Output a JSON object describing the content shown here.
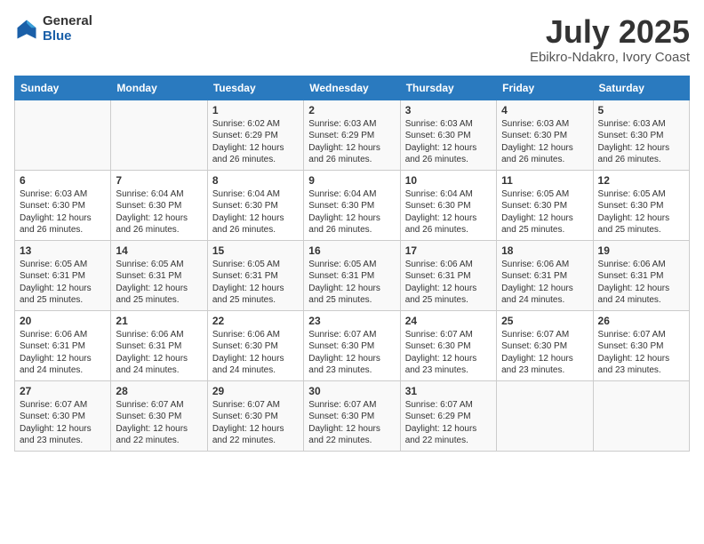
{
  "header": {
    "logo_general": "General",
    "logo_blue": "Blue",
    "title": "July 2025",
    "subtitle": "Ebikro-Ndakro, Ivory Coast"
  },
  "weekdays": [
    "Sunday",
    "Monday",
    "Tuesday",
    "Wednesday",
    "Thursday",
    "Friday",
    "Saturday"
  ],
  "weeks": [
    [
      {
        "day": "",
        "info": ""
      },
      {
        "day": "",
        "info": ""
      },
      {
        "day": "1",
        "info": "Sunrise: 6:02 AM\nSunset: 6:29 PM\nDaylight: 12 hours and 26 minutes."
      },
      {
        "day": "2",
        "info": "Sunrise: 6:03 AM\nSunset: 6:29 PM\nDaylight: 12 hours and 26 minutes."
      },
      {
        "day": "3",
        "info": "Sunrise: 6:03 AM\nSunset: 6:30 PM\nDaylight: 12 hours and 26 minutes."
      },
      {
        "day": "4",
        "info": "Sunrise: 6:03 AM\nSunset: 6:30 PM\nDaylight: 12 hours and 26 minutes."
      },
      {
        "day": "5",
        "info": "Sunrise: 6:03 AM\nSunset: 6:30 PM\nDaylight: 12 hours and 26 minutes."
      }
    ],
    [
      {
        "day": "6",
        "info": "Sunrise: 6:03 AM\nSunset: 6:30 PM\nDaylight: 12 hours and 26 minutes."
      },
      {
        "day": "7",
        "info": "Sunrise: 6:04 AM\nSunset: 6:30 PM\nDaylight: 12 hours and 26 minutes."
      },
      {
        "day": "8",
        "info": "Sunrise: 6:04 AM\nSunset: 6:30 PM\nDaylight: 12 hours and 26 minutes."
      },
      {
        "day": "9",
        "info": "Sunrise: 6:04 AM\nSunset: 6:30 PM\nDaylight: 12 hours and 26 minutes."
      },
      {
        "day": "10",
        "info": "Sunrise: 6:04 AM\nSunset: 6:30 PM\nDaylight: 12 hours and 26 minutes."
      },
      {
        "day": "11",
        "info": "Sunrise: 6:05 AM\nSunset: 6:30 PM\nDaylight: 12 hours and 25 minutes."
      },
      {
        "day": "12",
        "info": "Sunrise: 6:05 AM\nSunset: 6:30 PM\nDaylight: 12 hours and 25 minutes."
      }
    ],
    [
      {
        "day": "13",
        "info": "Sunrise: 6:05 AM\nSunset: 6:31 PM\nDaylight: 12 hours and 25 minutes."
      },
      {
        "day": "14",
        "info": "Sunrise: 6:05 AM\nSunset: 6:31 PM\nDaylight: 12 hours and 25 minutes."
      },
      {
        "day": "15",
        "info": "Sunrise: 6:05 AM\nSunset: 6:31 PM\nDaylight: 12 hours and 25 minutes."
      },
      {
        "day": "16",
        "info": "Sunrise: 6:05 AM\nSunset: 6:31 PM\nDaylight: 12 hours and 25 minutes."
      },
      {
        "day": "17",
        "info": "Sunrise: 6:06 AM\nSunset: 6:31 PM\nDaylight: 12 hours and 25 minutes."
      },
      {
        "day": "18",
        "info": "Sunrise: 6:06 AM\nSunset: 6:31 PM\nDaylight: 12 hours and 24 minutes."
      },
      {
        "day": "19",
        "info": "Sunrise: 6:06 AM\nSunset: 6:31 PM\nDaylight: 12 hours and 24 minutes."
      }
    ],
    [
      {
        "day": "20",
        "info": "Sunrise: 6:06 AM\nSunset: 6:31 PM\nDaylight: 12 hours and 24 minutes."
      },
      {
        "day": "21",
        "info": "Sunrise: 6:06 AM\nSunset: 6:31 PM\nDaylight: 12 hours and 24 minutes."
      },
      {
        "day": "22",
        "info": "Sunrise: 6:06 AM\nSunset: 6:30 PM\nDaylight: 12 hours and 24 minutes."
      },
      {
        "day": "23",
        "info": "Sunrise: 6:07 AM\nSunset: 6:30 PM\nDaylight: 12 hours and 23 minutes."
      },
      {
        "day": "24",
        "info": "Sunrise: 6:07 AM\nSunset: 6:30 PM\nDaylight: 12 hours and 23 minutes."
      },
      {
        "day": "25",
        "info": "Sunrise: 6:07 AM\nSunset: 6:30 PM\nDaylight: 12 hours and 23 minutes."
      },
      {
        "day": "26",
        "info": "Sunrise: 6:07 AM\nSunset: 6:30 PM\nDaylight: 12 hours and 23 minutes."
      }
    ],
    [
      {
        "day": "27",
        "info": "Sunrise: 6:07 AM\nSunset: 6:30 PM\nDaylight: 12 hours and 23 minutes."
      },
      {
        "day": "28",
        "info": "Sunrise: 6:07 AM\nSunset: 6:30 PM\nDaylight: 12 hours and 22 minutes."
      },
      {
        "day": "29",
        "info": "Sunrise: 6:07 AM\nSunset: 6:30 PM\nDaylight: 12 hours and 22 minutes."
      },
      {
        "day": "30",
        "info": "Sunrise: 6:07 AM\nSunset: 6:30 PM\nDaylight: 12 hours and 22 minutes."
      },
      {
        "day": "31",
        "info": "Sunrise: 6:07 AM\nSunset: 6:29 PM\nDaylight: 12 hours and 22 minutes."
      },
      {
        "day": "",
        "info": ""
      },
      {
        "day": "",
        "info": ""
      }
    ]
  ]
}
